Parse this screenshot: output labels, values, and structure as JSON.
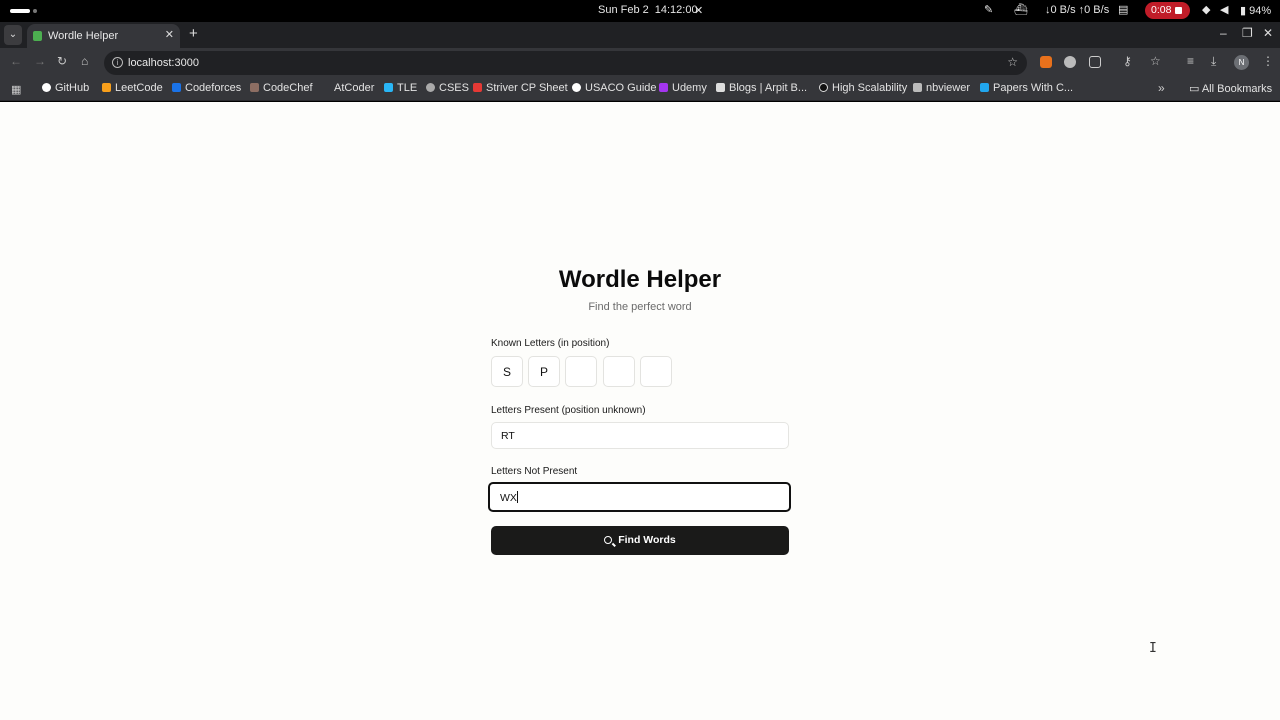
{
  "os": {
    "date": "Sun Feb 2",
    "time": "14:12:00",
    "network": "↓0 B/s ↑0 B/s",
    "recording": "0:08",
    "battery": "94%"
  },
  "browser": {
    "tab_title": "Wordle Helper",
    "url": "localhost:3000",
    "profile_initial": "N",
    "bookmarks": [
      {
        "label": "GitHub"
      },
      {
        "label": "LeetCode"
      },
      {
        "label": "Codeforces"
      },
      {
        "label": "CodeChef"
      },
      {
        "label": "AtCoder"
      },
      {
        "label": "TLE"
      },
      {
        "label": "CSES"
      },
      {
        "label": "Striver CP Sheet"
      },
      {
        "label": "USACO Guide"
      },
      {
        "label": "Udemy"
      },
      {
        "label": "Blogs | Arpit B..."
      },
      {
        "label": "High Scalability"
      },
      {
        "label": "nbviewer"
      },
      {
        "label": "Papers With C..."
      }
    ],
    "all_bookmarks": "All Bookmarks"
  },
  "app": {
    "title": "Wordle Helper",
    "subtitle": "Find the perfect word",
    "known_label": "Known Letters (in position)",
    "known_letters": [
      "S",
      "P",
      "",
      "",
      ""
    ],
    "present_label": "Letters Present (position unknown)",
    "present_value": "RT",
    "absent_label": "Letters Not Present",
    "absent_value": "WX",
    "button_label": "Find Words"
  }
}
